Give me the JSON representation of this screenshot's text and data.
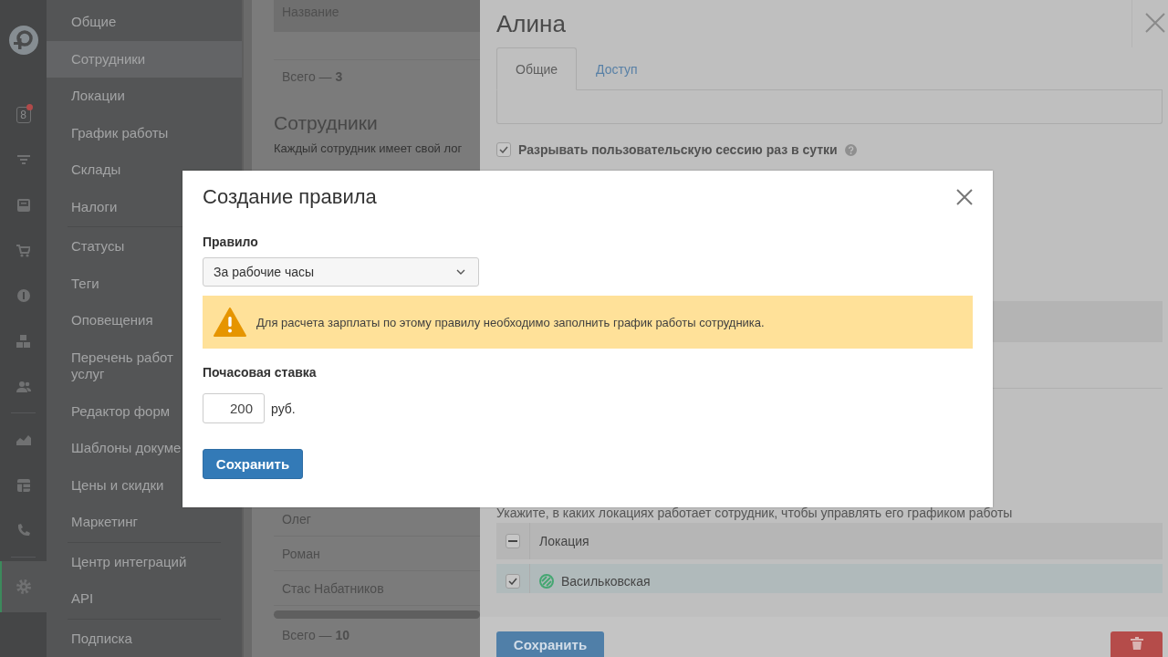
{
  "icon_rail": {
    "items": [
      {
        "kind": "logo",
        "selected": false
      },
      {
        "kind": "calendar",
        "badge": "8",
        "notification": true,
        "selected": false
      },
      {
        "kind": "filter",
        "selected": false
      },
      {
        "kind": "inbox",
        "selected": false
      },
      {
        "kind": "cart",
        "selected": false
      },
      {
        "kind": "dollar",
        "selected": false
      },
      {
        "kind": "boxes",
        "selected": false
      },
      {
        "kind": "users",
        "selected": false
      },
      {
        "kind": "divider"
      },
      {
        "kind": "chart",
        "selected": false
      },
      {
        "kind": "table",
        "selected": false
      },
      {
        "kind": "phone",
        "selected": false
      },
      {
        "kind": "divider"
      },
      {
        "kind": "gear",
        "selected": true
      }
    ]
  },
  "settings_menu": {
    "groups": [
      {
        "items": [
          {
            "label": "Общие",
            "selected": false
          },
          {
            "label": "Сотрудники",
            "selected": true
          },
          {
            "label": "Локации",
            "selected": false
          },
          {
            "label": "График работы",
            "selected": false
          },
          {
            "label": "Склады",
            "selected": false
          },
          {
            "label": "Налоги",
            "selected": false
          }
        ]
      },
      {
        "items": [
          {
            "label": "Статусы",
            "selected": false
          },
          {
            "label": "Теги",
            "selected": false
          },
          {
            "label": "Оповещения",
            "selected": false
          },
          {
            "label": "Перечень работ\nуслуг",
            "selected": false
          },
          {
            "label": "Редактор форм",
            "selected": false
          },
          {
            "label": "Шаблоны докуме",
            "selected": false
          },
          {
            "label": "Цены и скидки",
            "selected": false
          },
          {
            "label": "Маркетинг",
            "selected": false
          }
        ]
      },
      {
        "items": [
          {
            "label": "Центр интеграций",
            "selected": false
          },
          {
            "label": "API",
            "selected": false
          }
        ]
      },
      {
        "items": [
          {
            "label": "Подписка",
            "selected": false
          }
        ]
      }
    ]
  },
  "roles_table": {
    "columns": [
      "Название"
    ],
    "total": "Всего — **3**"
  },
  "employees": {
    "title": "Сотрудники",
    "description": "Каждый сотрудник имеет свой лог",
    "rows": [
      "Олег",
      "Роман",
      "Стас Набатников"
    ],
    "total": "Всего — **10**"
  },
  "drawer": {
    "title": "Алина",
    "tabs": [
      {
        "label": "Общие",
        "selected": true
      },
      {
        "label": "Доступ",
        "selected": false
      }
    ],
    "session_option": {
      "label": "Разрывать пользовательскую сессию раз в сутки",
      "checked": true
    },
    "locations_hint": "Укажите, в каких локациях работает сотрудник, чтобы управлять его графиком работы",
    "locations_table": {
      "columns": [
        "Локация"
      ],
      "select_all_partial": true,
      "rows": [
        {
          "name": "Васильковская",
          "checked": true,
          "selected": true,
          "color": "#45a772"
        }
      ]
    },
    "save_button": "Сохранить"
  },
  "modal": {
    "title": "Создание правила",
    "rule_label": "Правило",
    "rule_value": "За рабочие часы",
    "warning": "Для расчета зарплаты по этому правилу необходимо заполнить график работы сотрудника.",
    "rate_label": "Почасовая ставка",
    "rate_value": "200",
    "unit": "руб.",
    "save_button": "Сохранить"
  }
}
